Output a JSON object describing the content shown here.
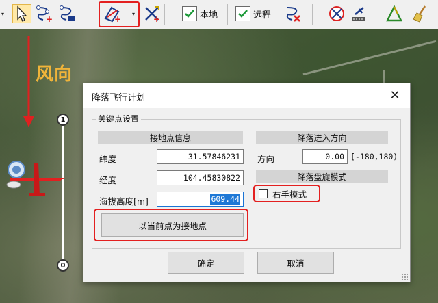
{
  "annotation": {
    "wind_label": "风向"
  },
  "toolbar": {
    "local_label": "本地",
    "remote_label": "远程"
  },
  "map": {
    "waypoint_top": "1",
    "waypoint_bottom": "0"
  },
  "dialog": {
    "title": "降落飞行计划",
    "close": "✕",
    "group_title": "关键点设置",
    "landing_section": "接地点信息",
    "direction_section": "降落进入方向",
    "circling_section": "降落盘旋模式",
    "latitude_label": "纬度",
    "latitude_value": "31.57846231",
    "longitude_label": "经度",
    "longitude_value": "104.45830822",
    "altitude_label": "海拔高度[m]",
    "altitude_value": "609.44",
    "direction_label": "方向",
    "direction_value": "0.00",
    "direction_range": "[-180,180)",
    "right_hand_label": "右手模式",
    "right_hand_checked": false,
    "set_current_button": "以当前点为接地点",
    "ok_button": "确定",
    "cancel_button": "取消"
  },
  "colors": {
    "highlight_red": "#e32020",
    "wind_label": "#f0b43a",
    "selection_blue": "#1e78d6"
  }
}
